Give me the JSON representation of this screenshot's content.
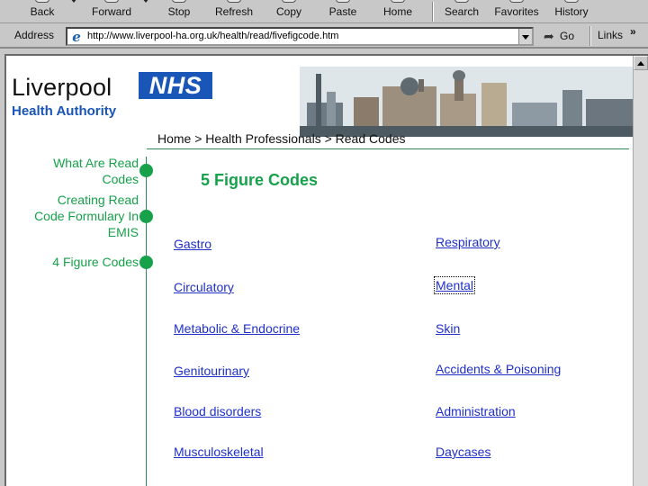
{
  "browser": {
    "toolbar": {
      "buttons": [
        {
          "label": "Back"
        },
        {
          "label": "Forward"
        },
        {
          "label": "Stop"
        },
        {
          "label": "Refresh"
        },
        {
          "label": "Copy"
        },
        {
          "label": "Paste"
        },
        {
          "label": "Home"
        },
        {
          "label": "Search"
        },
        {
          "label": "Favorites"
        },
        {
          "label": "History"
        }
      ]
    },
    "address": {
      "label": "Address",
      "url": "http://www.liverpool-ha.org.uk/health/read/fivefigcode.htm",
      "go_label": "Go",
      "links_label": "Links",
      "links_chevron": "»",
      "page_icon": "internet-explorer-icon"
    }
  },
  "page": {
    "logo": {
      "name": "Liverpool",
      "nhs": "NHS",
      "subtitle": "Health Authority"
    },
    "breadcrumb": "Home > Health Professionals > Read Codes",
    "nav": [
      {
        "label_lines": [
          "What Are Read",
          "Codes"
        ]
      },
      {
        "label_lines": [
          "Creating Read",
          "Code Formulary In",
          "EMIS"
        ]
      },
      {
        "label_lines": [
          "4 Figure Codes"
        ]
      }
    ],
    "title": "5 Figure Codes",
    "codes_left": [
      "Gastro",
      "Circulatory",
      "Metabolic & Endocrine",
      "Genitourinary",
      "Blood disorders",
      "Musculoskeletal"
    ],
    "codes_right": [
      "Respiratory",
      "Mental",
      "Skin",
      "Accidents & Poisoning",
      "Administration",
      "Daycases"
    ],
    "focused_link": "Mental",
    "colors": {
      "nav_green": "#16a14a",
      "link_blue": "#1f2fc8",
      "nhs_blue": "#1a55b8"
    }
  }
}
